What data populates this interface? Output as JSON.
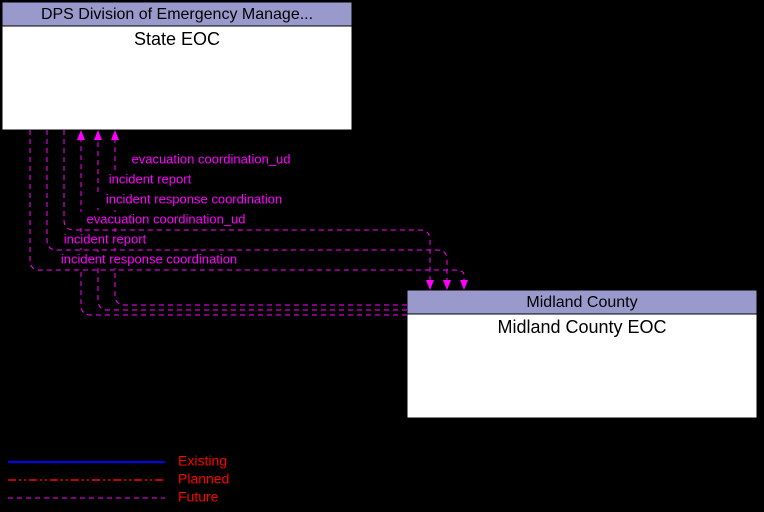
{
  "nodes": {
    "top": {
      "header": "DPS Division of Emergency Manage...",
      "body": "State EOC"
    },
    "bottom": {
      "header": "Midland County",
      "body": "Midland County EOC"
    }
  },
  "flows": {
    "to_top": [
      "evacuation coordination_ud",
      "incident report",
      "incident response coordination"
    ],
    "to_bottom": [
      "evacuation coordination_ud",
      "incident report",
      "incident response coordination"
    ]
  },
  "legend": {
    "existing": "Existing",
    "planned": "Planned",
    "future": "Future"
  }
}
